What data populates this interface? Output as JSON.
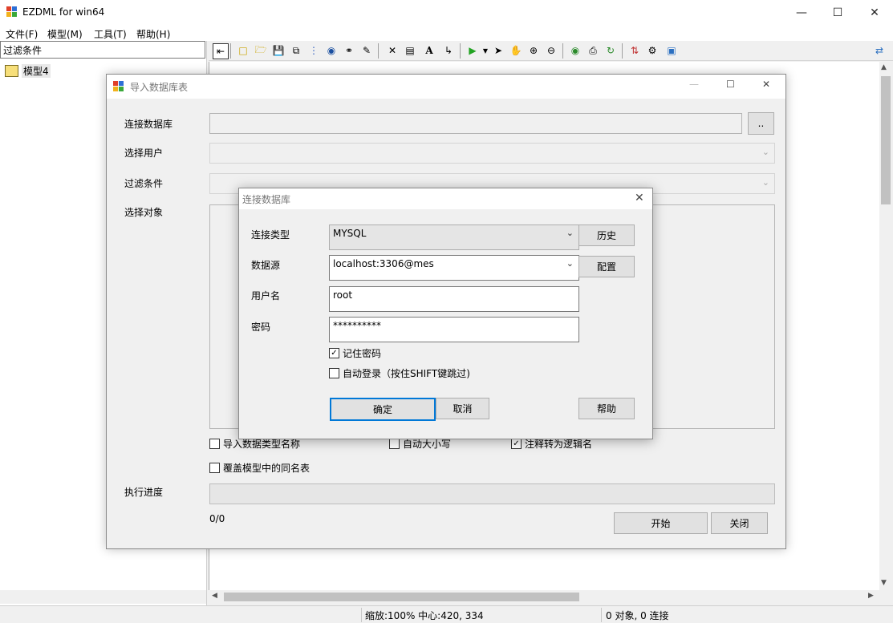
{
  "app": {
    "title": "EZDML for win64"
  },
  "menu": [
    "文件(F)",
    "模型(M)",
    "工具(T)",
    "帮助(H)"
  ],
  "left_panel": {
    "filter_placeholder": "过滤条件",
    "tree_item": "模型4"
  },
  "status": {
    "zoom": "缩放:100% 中心:420, 334",
    "counts": "0 对象, 0 连接"
  },
  "import_dialog": {
    "title": "导入数据库表",
    "connect_db_label": "连接数据库",
    "browse_label": "..",
    "select_user_label": "选择用户",
    "filter_label": "过滤条件",
    "select_objects_label": "选择对象",
    "opt_import_types": "导入数据类型名称",
    "opt_auto_case": "自动大小写",
    "opt_comment_logical": "注释转为逻辑名",
    "opt_overwrite": "覆盖模型中的同名表",
    "progress_label": "执行进度",
    "progress_text": "0/0",
    "start_label": "开始",
    "close_label": "关闭",
    "checked": {
      "import_types": false,
      "auto_case": false,
      "comment_logical": true,
      "overwrite": false
    }
  },
  "connect_dialog": {
    "title": "连接数据库",
    "conn_type_label": "连接类型",
    "conn_type_value": "MYSQL",
    "history_label": "历史",
    "datasource_label": "数据源",
    "datasource_value": "localhost:3306@mes",
    "config_label": "配置",
    "username_label": "用户名",
    "username_value": "root",
    "password_label": "密码",
    "password_value": "**********",
    "remember_label": "记住密码",
    "remember_checked": true,
    "autologin_label": "自动登录（按住SHIFT键跳过)",
    "autologin_checked": false,
    "ok_label": "确定",
    "cancel_label": "取消",
    "help_label": "帮助"
  }
}
